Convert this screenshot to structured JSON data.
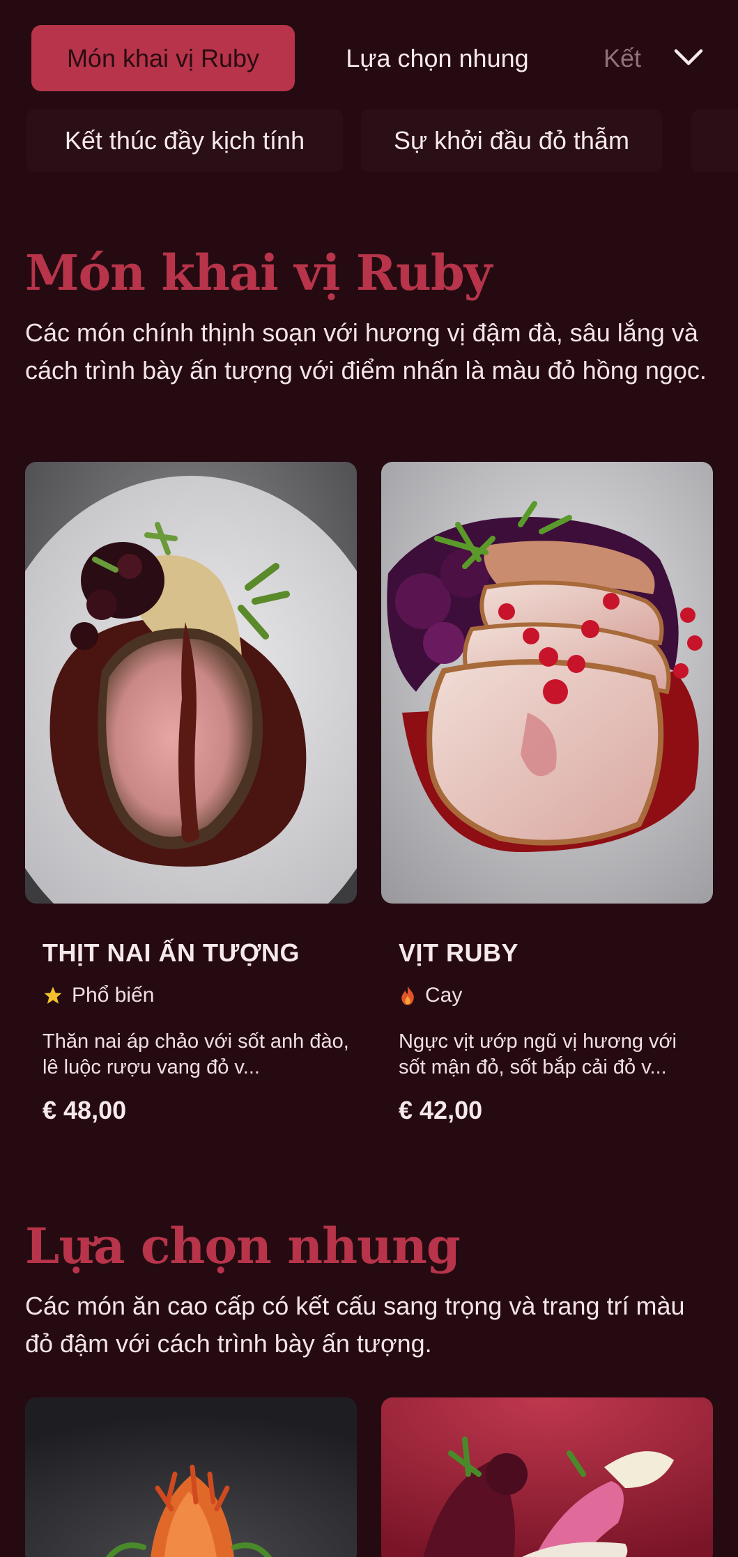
{
  "tabs": [
    {
      "label": "Món khai vị Ruby",
      "active": true
    },
    {
      "label": "Lựa chọn nhung",
      "active": false
    },
    {
      "label": "Kết",
      "active": false
    }
  ],
  "tabs_row2": [
    {
      "label": "Kết thúc đầy kịch tính"
    },
    {
      "label": "Sự khởi đầu đỏ thẫm"
    }
  ],
  "sections": [
    {
      "title": "Món khai vị Ruby",
      "description": "Các món chính thịnh soạn với hương vị đậm đà, sâu lắng và cách trình bày ấn tượng với điểm nhấn là màu đỏ hồng ngọc.",
      "items": [
        {
          "name": "THỊT NAI ẤN TƯỢNG",
          "tag": "Phổ biến",
          "tag_icon": "star-icon",
          "description": "Thăn nai áp chảo với sốt anh đào, lê luộc rượu vang đỏ v...",
          "price": "€ 48,00"
        },
        {
          "name": "VỊT RUBY",
          "tag": "Cay",
          "tag_icon": "flame-icon",
          "description": "Ngực vịt ướp ngũ vị hương với sốt mận đỏ, sốt bắp cải đỏ v...",
          "price": "€ 42,00"
        }
      ]
    },
    {
      "title": "Lựa chọn nhung",
      "description": "Các món ăn cao cấp có kết cấu sang trọng và trang trí màu đỏ đậm với cách trình bày ấn tượng."
    }
  ],
  "colors": {
    "background": "#250b11",
    "accent": "#b7344a",
    "star": "#f2c12e",
    "flame": "#e2552b"
  }
}
